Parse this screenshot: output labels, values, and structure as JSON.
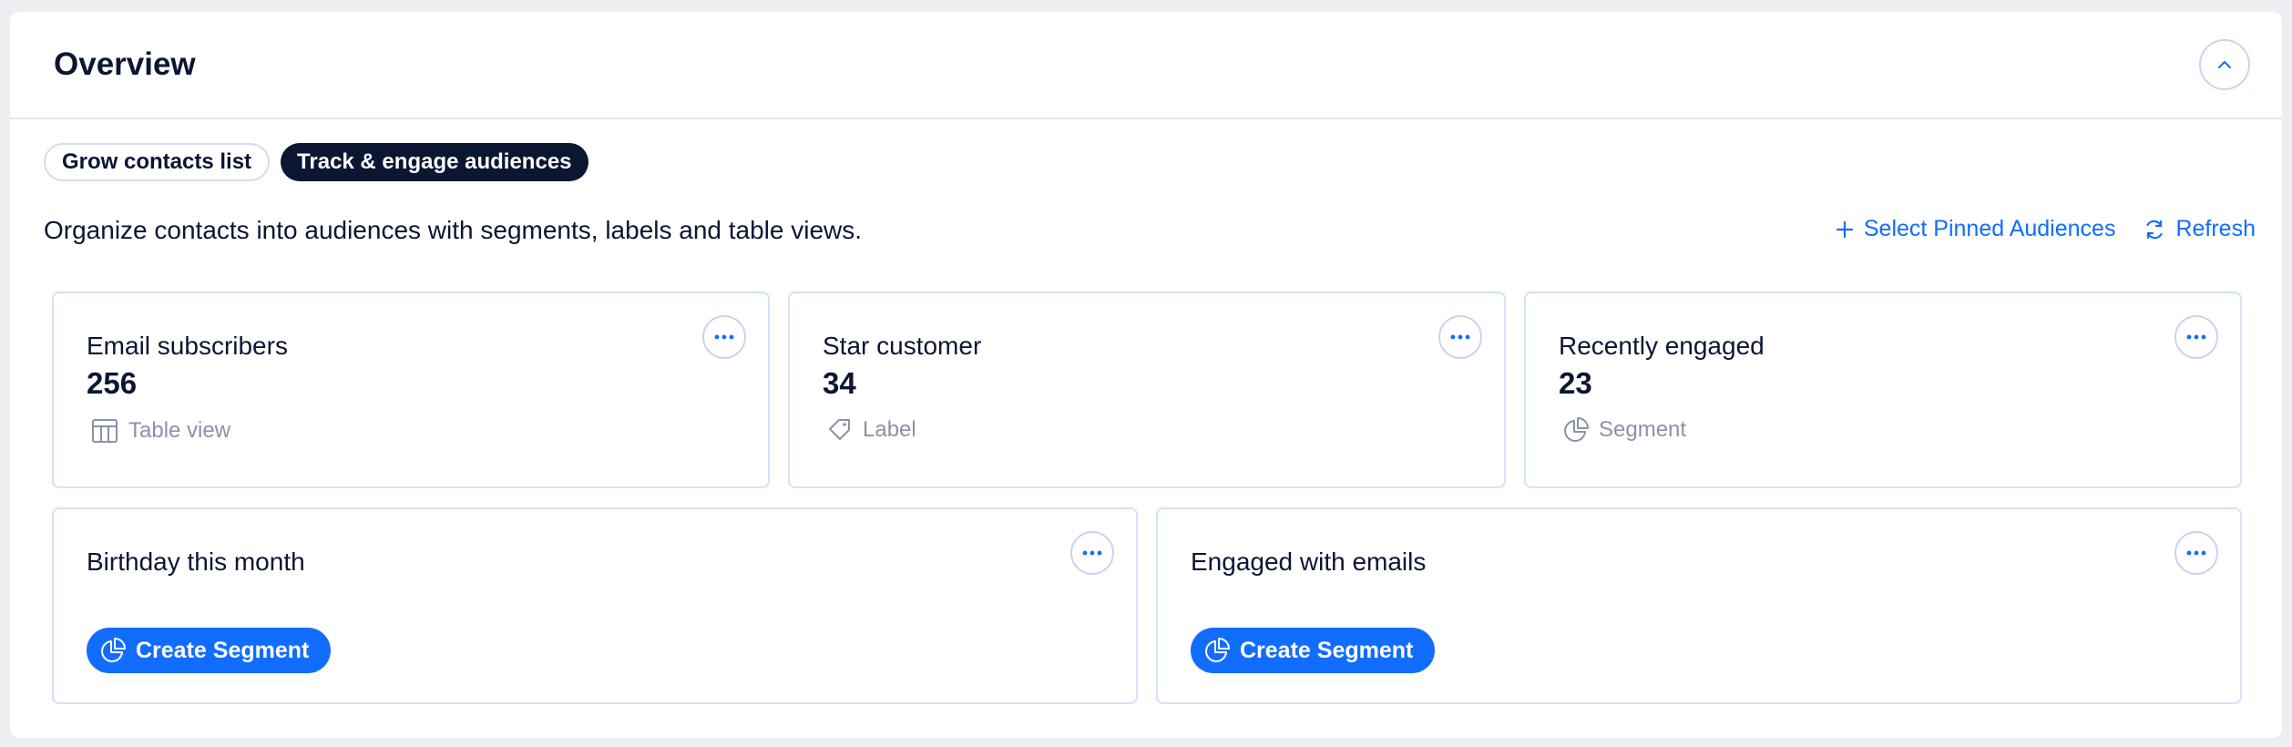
{
  "header": {
    "title": "Overview"
  },
  "tabs": [
    {
      "label": "Grow contacts list",
      "active": false
    },
    {
      "label": "Track & engage audiences",
      "active": true
    }
  ],
  "description": "Organize contacts into audiences with segments, labels and table views.",
  "actions": {
    "select_pinned": "Select Pinned Audiences",
    "refresh": "Refresh"
  },
  "cards": [
    {
      "title": "Email subscribers",
      "count": "256",
      "type_label": "Table view",
      "type_icon": "table-icon"
    },
    {
      "title": "Star customer",
      "count": "34",
      "type_label": "Label",
      "type_icon": "tag-icon"
    },
    {
      "title": "Recently engaged",
      "count": "23",
      "type_label": "Segment",
      "type_icon": "pie-chart-icon"
    }
  ],
  "suggested_cards": [
    {
      "title": "Birthday this month",
      "button_label": "Create Segment"
    },
    {
      "title": "Engaged with emails",
      "button_label": "Create Segment"
    }
  ],
  "colors": {
    "accent": "#116dff",
    "dark": "#0b1633",
    "muted": "#8a93a6",
    "border": "#d3e2f7"
  }
}
